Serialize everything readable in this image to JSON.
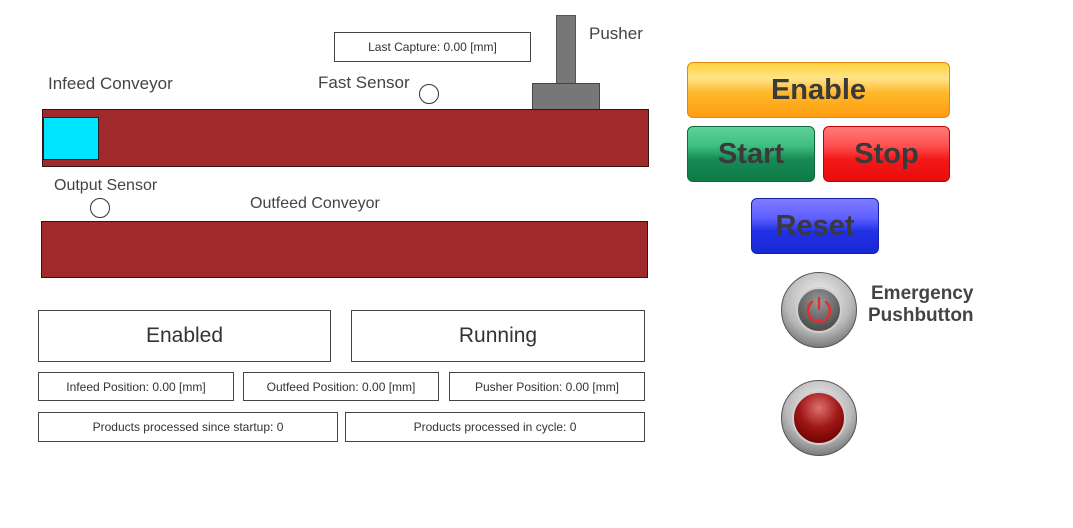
{
  "hmi": {
    "last_capture": "Last Capture: 0.00 [mm]",
    "labels": {
      "pusher": "Pusher",
      "infeed_conveyor": "Infeed Conveyor",
      "fast_sensor": "Fast Sensor",
      "output_sensor": "Output Sensor",
      "outfeed_conveyor": "Outfeed Conveyor"
    },
    "status": {
      "enabled": "Enabled",
      "running": "Running"
    },
    "positions": {
      "infeed": "Infeed Position: 0.00 [mm]",
      "outfeed": "Outfeed Position: 0.00 [mm]",
      "pusher": "Pusher Position: 0.00 [mm]"
    },
    "counters": {
      "since_startup": "Products processed since startup: 0",
      "in_cycle": "Products processed in cycle: 0"
    }
  },
  "controls": {
    "enable": "Enable",
    "start": "Start",
    "stop": "Stop",
    "reset": "Reset",
    "emergency_line1": "Emergency",
    "emergency_line2": "Pushbutton"
  },
  "colors": {
    "conveyor": "#a0292b",
    "product": "#00e5ff",
    "pusher": "#777777"
  },
  "icons": {
    "emergency": "power-icon",
    "indicator": "red-indicator-light"
  }
}
